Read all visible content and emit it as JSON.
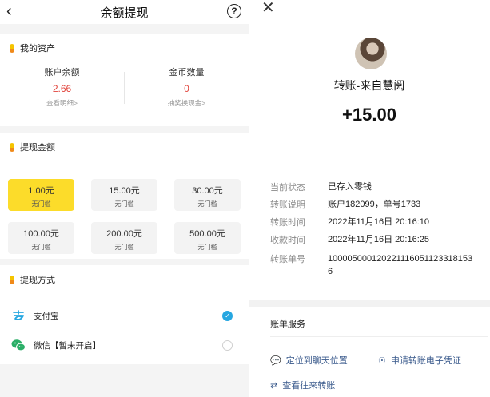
{
  "left": {
    "nav": {
      "back_icon": "chevron-left-icon",
      "title": "余额提现",
      "help_icon": "help-circle-icon",
      "help_glyph": "?"
    },
    "assets": {
      "section_title": "我的资产",
      "balance": {
        "label": "账户余额",
        "value": "2.66",
        "link": "查看明细>"
      },
      "coins": {
        "label": "金币数量",
        "value": "0",
        "link": "抽奖换现金>"
      }
    },
    "withdraw": {
      "section_title": "提现金额",
      "options": [
        {
          "value": "1.00元",
          "sub": "无门槛",
          "selected": true
        },
        {
          "value": "15.00元",
          "sub": "无门槛",
          "selected": false
        },
        {
          "value": "30.00元",
          "sub": "无门槛",
          "selected": false
        },
        {
          "value": "100.00元",
          "sub": "无门槛",
          "selected": false
        },
        {
          "value": "200.00元",
          "sub": "无门槛",
          "selected": false
        },
        {
          "value": "500.00元",
          "sub": "无门槛",
          "selected": false
        }
      ]
    },
    "payment": {
      "section_title": "提现方式",
      "methods": [
        {
          "name": "支付宝",
          "icon": "alipay-icon",
          "checked": true
        },
        {
          "name": "微信【暂未开启】",
          "icon": "wechat-icon",
          "checked": false
        }
      ]
    }
  },
  "right": {
    "close_icon": "close-icon",
    "from": "转账-来自慧阅",
    "amount": "+15.00",
    "details": [
      {
        "label": "当前状态",
        "value": "已存入零钱"
      },
      {
        "label": "转账说明",
        "value": "账户182099，单号1733"
      },
      {
        "label": "转账时间",
        "value": "2022年11月16日 20:16:10"
      },
      {
        "label": "收款时间",
        "value": "2022年11月16日 20:16:25"
      },
      {
        "label": "转账单号",
        "value": "1000050001202211160511233181536"
      }
    ],
    "service_title": "账单服务",
    "services": [
      {
        "label": "定位到聊天位置",
        "icon": "chat-bubble-icon"
      },
      {
        "label": "申请转账电子凭证",
        "icon": "certificate-icon"
      },
      {
        "label": "查看往来转账",
        "icon": "transfer-arrows-icon"
      }
    ]
  },
  "colors": {
    "accent_yellow": "#fcdc2a",
    "alert_red": "#e1433b",
    "link_blue": "#3a5a8c",
    "alipay_blue": "#27a7e1",
    "wechat_green": "#2aae67"
  }
}
